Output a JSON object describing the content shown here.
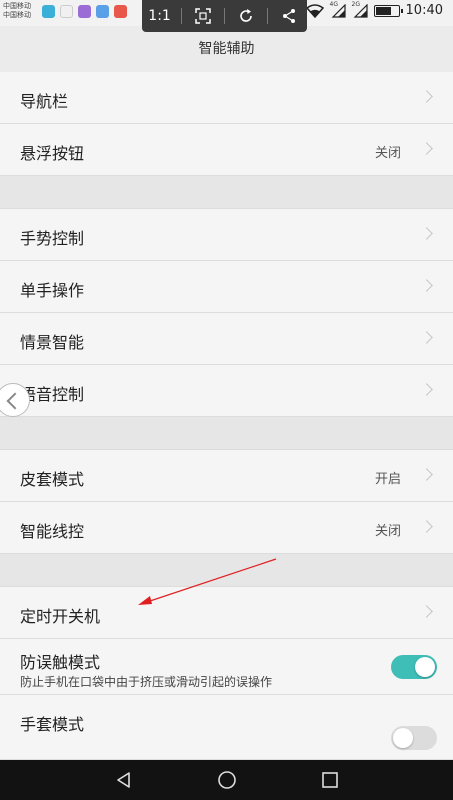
{
  "status_bar": {
    "carrier_1": "中国移动",
    "carrier_2": "中国移动",
    "signal_1_label": "4G",
    "signal_2_label": "2G",
    "battery_level": 0.75,
    "time": "10:40"
  },
  "toolbar": {
    "ratio_label": "1:1"
  },
  "header": {
    "title": "智能辅助"
  },
  "groups": [
    {
      "items": [
        {
          "label": "导航栏",
          "value": ""
        },
        {
          "label": "悬浮按钮",
          "value": "关闭"
        }
      ]
    },
    {
      "items": [
        {
          "label": "手势控制",
          "value": ""
        },
        {
          "label": "单手操作",
          "value": ""
        },
        {
          "label": "情景智能",
          "value": ""
        },
        {
          "label": "语音控制",
          "value": ""
        }
      ]
    },
    {
      "items": [
        {
          "label": "皮套模式",
          "value": "开启"
        },
        {
          "label": "智能线控",
          "value": "关闭"
        }
      ]
    },
    {
      "items": [
        {
          "label": "定时开关机",
          "value": ""
        }
      ]
    }
  ],
  "toggles": [
    {
      "label": "防误触模式",
      "subtitle": "防止手机在口袋中由于挤压或滑动引起的误操作",
      "on": true
    },
    {
      "label": "手套模式",
      "on": false
    }
  ],
  "colors": {
    "accent": "#3fbdb7",
    "annotation": "#e02020",
    "background": "#ebebeb",
    "row": "#f5f5f5"
  }
}
